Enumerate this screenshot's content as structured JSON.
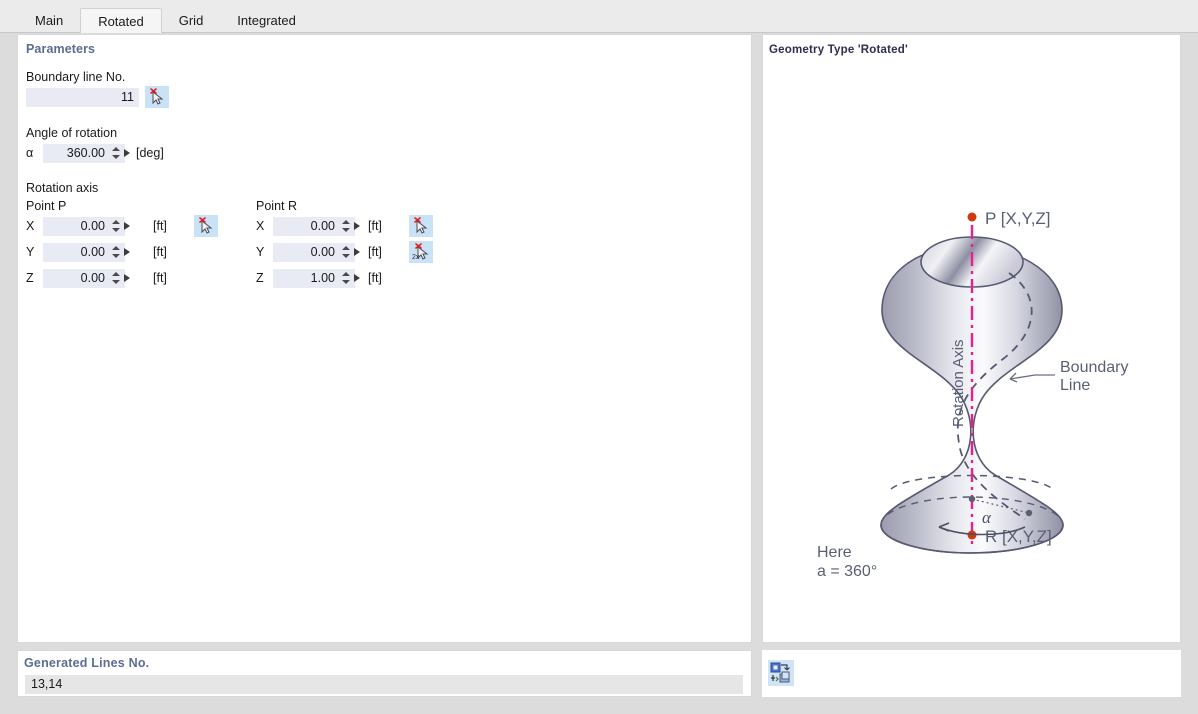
{
  "tabs": [
    {
      "label": "Main",
      "active": false
    },
    {
      "label": "Rotated",
      "active": true
    },
    {
      "label": "Grid",
      "active": false
    },
    {
      "label": "Integrated",
      "active": false
    }
  ],
  "left_panel": {
    "section_title": "Parameters",
    "boundary_line": {
      "label": "Boundary line No.",
      "value": "11",
      "pick_icon": "pick-cursor-icon"
    },
    "angle_of_rotation": {
      "group_label": "Angle of rotation",
      "symbol": "α",
      "value": "360.00",
      "unit": "[deg]"
    },
    "rotation_axis": {
      "group_label": "Rotation axis",
      "point_p": {
        "title": "Point P",
        "rows": [
          {
            "axis": "X",
            "value": "0.00",
            "unit": "[ft]"
          },
          {
            "axis": "Y",
            "value": "0.00",
            "unit": "[ft]"
          },
          {
            "axis": "Z",
            "value": "0.00",
            "unit": "[ft]"
          }
        ],
        "pick_icon": "pick-cursor-icon"
      },
      "point_r": {
        "title": "Point R",
        "rows": [
          {
            "axis": "X",
            "value": "0.00",
            "unit": "[ft]"
          },
          {
            "axis": "Y",
            "value": "0.00",
            "unit": "[ft]"
          },
          {
            "axis": "Z",
            "value": "1.00",
            "unit": "[ft]"
          }
        ],
        "pick_icon": "pick-cursor-icon",
        "pick_icon_2": "pick-two-points-icon"
      }
    }
  },
  "right_panel": {
    "caption": "Geometry Type 'Rotated'",
    "figure": {
      "point_p_label": "P [X,Y,Z]",
      "point_r_label": "R [X,Y,Z]",
      "axis_label": "Rotation Axis",
      "boundary_label_line1": "Boundary",
      "boundary_label_line2": "Line",
      "angle_symbol": "α",
      "note_line1": "Here",
      "note_line2": "a = 360°",
      "colors": {
        "axis": "#e5218f",
        "point": "#d2380f",
        "outline": "#555a72",
        "text": "#5a5f73"
      }
    }
  },
  "bottom_left_panel": {
    "caption": "Generated Lines No.",
    "value": "13,14"
  },
  "bottom_right_bar": {
    "tool_icon": "transfer-settings-icon"
  }
}
